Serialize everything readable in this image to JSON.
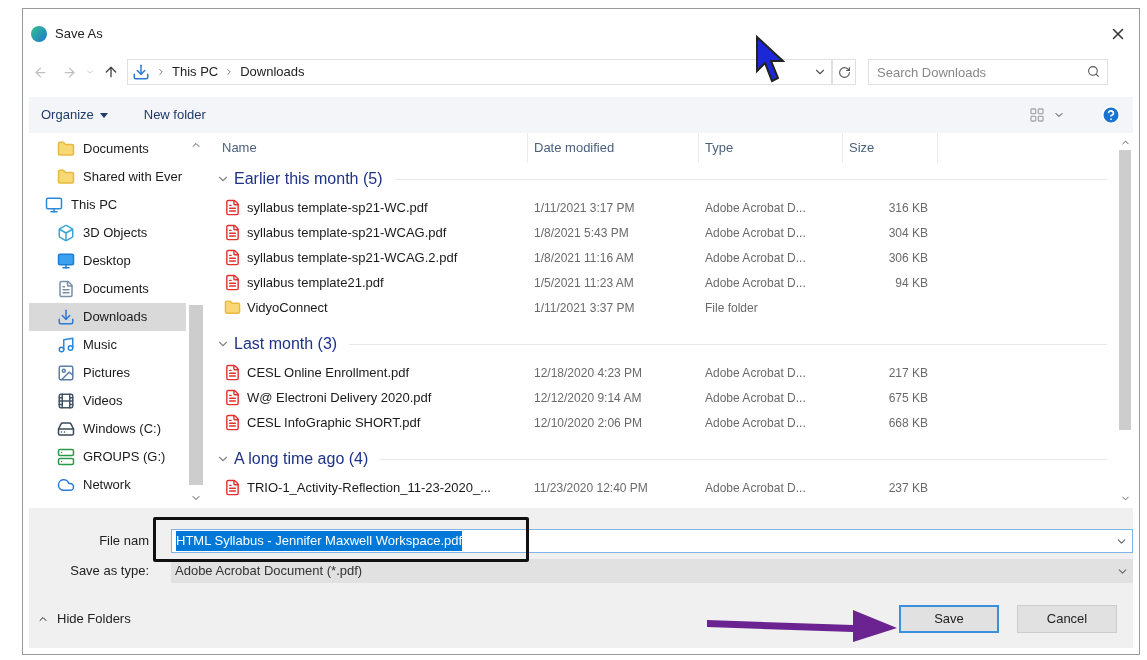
{
  "window": {
    "title": "Save As"
  },
  "address": {
    "breadcrumb": [
      "This PC",
      "Downloads"
    ]
  },
  "search": {
    "placeholder": "Search Downloads"
  },
  "toolbar": {
    "organize": "Organize",
    "new_folder": "New folder"
  },
  "sidebar": {
    "items": [
      {
        "label": "Documents",
        "kind": "folder",
        "selected": false
      },
      {
        "label": "Shared with Ever",
        "kind": "folder",
        "selected": false
      },
      {
        "label": "This PC",
        "kind": "pc",
        "selected": false,
        "children": [
          {
            "label": "3D Objects",
            "kind": "objects",
            "selected": false
          },
          {
            "label": "Desktop",
            "kind": "desktop",
            "selected": false
          },
          {
            "label": "Documents",
            "kind": "documents",
            "selected": false
          },
          {
            "label": "Downloads",
            "kind": "downloads",
            "selected": true
          },
          {
            "label": "Music",
            "kind": "music",
            "selected": false
          },
          {
            "label": "Pictures",
            "kind": "pictures",
            "selected": false
          },
          {
            "label": "Videos",
            "kind": "videos",
            "selected": false
          },
          {
            "label": "Windows (C:)",
            "kind": "drive",
            "selected": false
          },
          {
            "label": "GROUPS (G:)",
            "kind": "netdrive",
            "selected": false
          }
        ]
      },
      {
        "label": "Network",
        "kind": "network",
        "selected": false
      }
    ]
  },
  "table": {
    "columns": [
      "Name",
      "Date modified",
      "Type",
      "Size"
    ],
    "groups": [
      {
        "label": "Earlier this month (5)",
        "expanded": true,
        "rows": [
          {
            "name": "syllabus template-sp21-WC.pdf",
            "date": "1/11/2021 3:17 PM",
            "type": "Adobe Acrobat D...",
            "size": "316 KB",
            "kind": "pdf"
          },
          {
            "name": "syllabus template-sp21-WCAG.pdf",
            "date": "1/8/2021 5:43 PM",
            "type": "Adobe Acrobat D...",
            "size": "304 KB",
            "kind": "pdf"
          },
          {
            "name": "syllabus template-sp21-WCAG.2.pdf",
            "date": "1/8/2021 11:16 AM",
            "type": "Adobe Acrobat D...",
            "size": "306 KB",
            "kind": "pdf"
          },
          {
            "name": "syllabus template21.pdf",
            "date": "1/5/2021 11:23 AM",
            "type": "Adobe Acrobat D...",
            "size": "94 KB",
            "kind": "pdf"
          },
          {
            "name": "VidyoConnect",
            "date": "1/11/2021 3:37 PM",
            "type": "File folder",
            "kind": "folder"
          }
        ]
      },
      {
        "label": "Last month (3)",
        "expanded": true,
        "rows": [
          {
            "name": "CESL Online Enrollment.pdf",
            "date": "12/18/2020 4:23 PM",
            "type": "Adobe Acrobat D...",
            "size": "217 KB",
            "kind": "pdf"
          },
          {
            "name": "W@ Electroni Delivery 2020.pdf",
            "date": "12/12/2020 9:14 AM",
            "type": "Adobe Acrobat D...",
            "size": "675 KB",
            "kind": "pdf"
          },
          {
            "name": "CESL InfoGraphic SHORT.pdf",
            "date": "12/10/2020 2:06 PM",
            "type": "Adobe Acrobat D...",
            "size": "668 KB",
            "kind": "pdf"
          }
        ]
      },
      {
        "label": "A long time ago (4)",
        "expanded": true,
        "rows": [
          {
            "name": "TRIO-1_Activity-Reflection_11-23-2020_...",
            "date": "11/23/2020 12:40 PM",
            "type": "Adobe Acrobat D...",
            "size": "237 KB",
            "kind": "pdf"
          }
        ]
      }
    ]
  },
  "file_name": {
    "label": "File nam",
    "value": "HTML Syllabus - Jennifer Maxwell Workspace.pdf",
    "selected": true
  },
  "save_type": {
    "label": "Save as type:",
    "value": "Adobe Acrobat Document (*.pdf)"
  },
  "hide_folders": "Hide Folders",
  "buttons": [
    {
      "label": "Save",
      "default": true
    },
    {
      "label": "Cancel",
      "default": false
    }
  ]
}
